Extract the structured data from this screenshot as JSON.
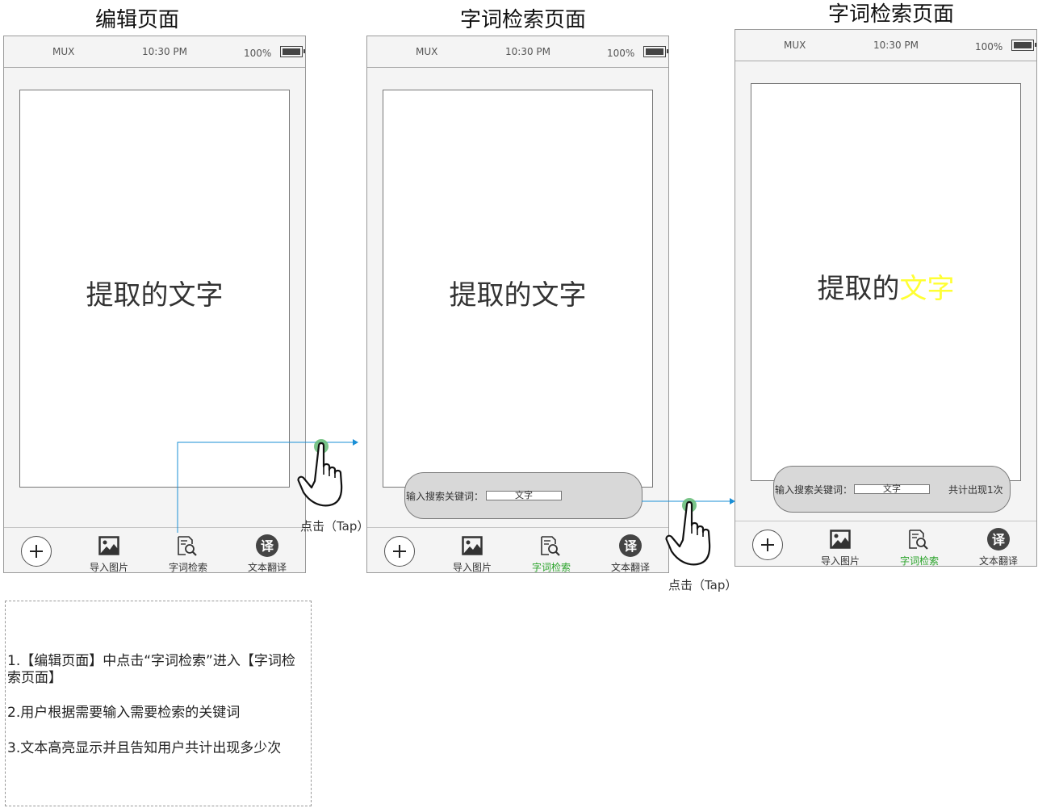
{
  "screens": [
    {
      "title": "编辑页面",
      "status": {
        "carrier": "MUX",
        "time": "10:30 PM",
        "battery": "100%"
      },
      "content_text": "提取的文字",
      "tabs": [
        "导入图片",
        "字词检索",
        "文本翻译"
      ],
      "tab_badge": "译"
    },
    {
      "title": "字词检索页面",
      "status": {
        "carrier": "MUX",
        "time": "10:30 PM",
        "battery": "100%"
      },
      "content_text": "提取的文字",
      "search": {
        "label": "输入搜索关键词：",
        "keyword": "文字"
      },
      "tabs": [
        "导入图片",
        "字词检索",
        "文本翻译"
      ],
      "tab_badge": "译",
      "active_tab": "字词检索"
    },
    {
      "title": "字词检索页面",
      "status": {
        "carrier": "MUX",
        "time": "10:30 PM",
        "battery": "100%"
      },
      "content_text_plain": "提取的",
      "content_text_highlight": "文字",
      "search": {
        "label": "输入搜索关键词：",
        "keyword": "文字",
        "result": "共计出现1次"
      },
      "tabs": [
        "导入图片",
        "字词检索",
        "文本翻译"
      ],
      "tab_badge": "译",
      "active_tab": "字词检索"
    }
  ],
  "tap_label": "点击（Tap）",
  "notes": [
    "1.【编辑页面】中点击“字词检索”进入【字词检索页面】",
    "2.用户根据需要输入需要检索的关键词",
    "3.文本高亮显示并且告知用户共计出现多少次"
  ],
  "colors": {
    "arrow": "#1a8fd6",
    "active_tab": "#2aa32a",
    "highlight": "#ffff33",
    "tap_dot": "#6cbf7c"
  }
}
